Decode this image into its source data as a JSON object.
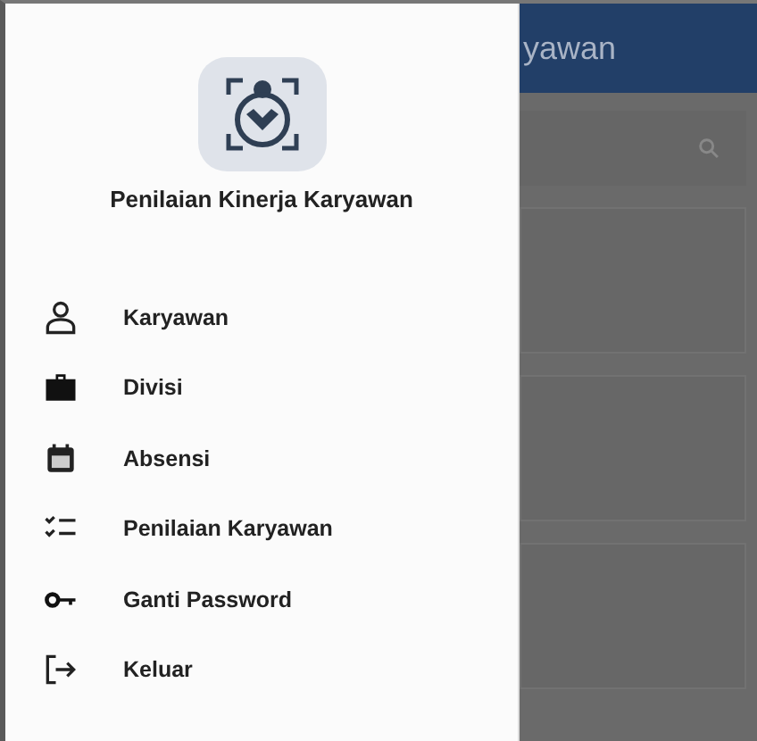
{
  "app": {
    "title": "yawan"
  },
  "drawer": {
    "title": "Penilaian Kinerja Karyawan",
    "items": [
      {
        "label": "Karyawan"
      },
      {
        "label": "Divisi"
      },
      {
        "label": "Absensi"
      },
      {
        "label": "Penilaian Karyawan"
      },
      {
        "label": "Ganti Password"
      },
      {
        "label": "Keluar"
      }
    ]
  }
}
